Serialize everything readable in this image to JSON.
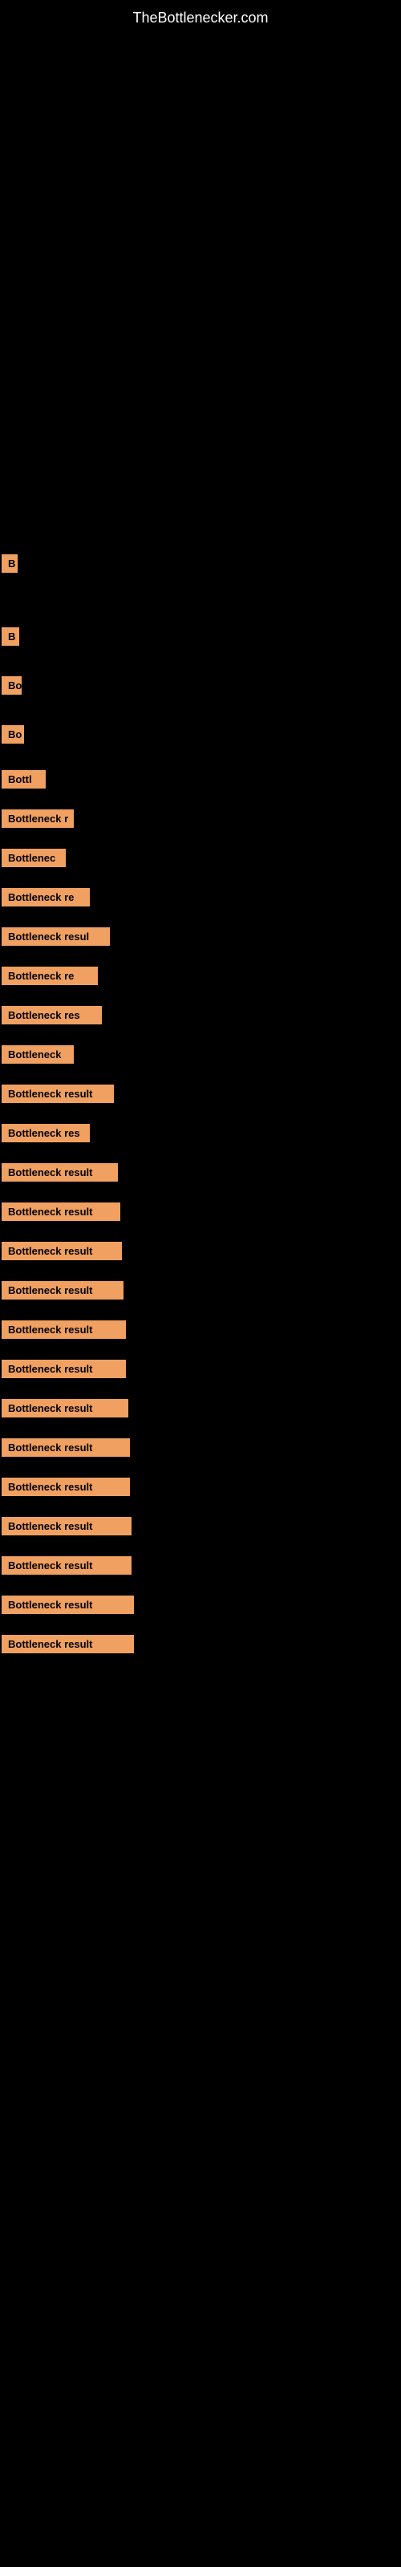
{
  "site": {
    "title": "TheBottlenecker.com"
  },
  "bars": [
    {
      "id": 1,
      "label": "B",
      "class": "bar-1"
    },
    {
      "id": 2,
      "label": "B",
      "class": "bar-2"
    },
    {
      "id": 3,
      "label": "Bo",
      "class": "bar-3"
    },
    {
      "id": 4,
      "label": "Bo",
      "class": "bar-4"
    },
    {
      "id": 5,
      "label": "Bottl",
      "class": "bar-5"
    },
    {
      "id": 6,
      "label": "Bottleneck r",
      "class": "bar-6"
    },
    {
      "id": 7,
      "label": "Bottlenec",
      "class": "bar-7"
    },
    {
      "id": 8,
      "label": "Bottleneck re",
      "class": "bar-8"
    },
    {
      "id": 9,
      "label": "Bottleneck resul",
      "class": "bar-9"
    },
    {
      "id": 10,
      "label": "Bottleneck re",
      "class": "bar-10"
    },
    {
      "id": 11,
      "label": "Bottleneck res",
      "class": "bar-11"
    },
    {
      "id": 12,
      "label": "Bottleneck",
      "class": "bar-12"
    },
    {
      "id": 13,
      "label": "Bottleneck result",
      "class": "bar-13"
    },
    {
      "id": 14,
      "label": "Bottleneck res",
      "class": "bar-14"
    },
    {
      "id": 15,
      "label": "Bottleneck result",
      "class": "bar-15"
    },
    {
      "id": 16,
      "label": "Bottleneck result",
      "class": "bar-16"
    },
    {
      "id": 17,
      "label": "Bottleneck result",
      "class": "bar-17"
    },
    {
      "id": 18,
      "label": "Bottleneck result",
      "class": "bar-18"
    },
    {
      "id": 19,
      "label": "Bottleneck result",
      "class": "bar-19"
    },
    {
      "id": 20,
      "label": "Bottleneck result",
      "class": "bar-20"
    },
    {
      "id": 21,
      "label": "Bottleneck result",
      "class": "bar-21"
    },
    {
      "id": 22,
      "label": "Bottleneck result",
      "class": "bar-22"
    },
    {
      "id": 23,
      "label": "Bottleneck result",
      "class": "bar-23"
    },
    {
      "id": 24,
      "label": "Bottleneck result",
      "class": "bar-24"
    },
    {
      "id": 25,
      "label": "Bottleneck result",
      "class": "bar-25"
    },
    {
      "id": 26,
      "label": "Bottleneck result",
      "class": "bar-26"
    },
    {
      "id": 27,
      "label": "Bottleneck result",
      "class": "bar-27"
    }
  ]
}
